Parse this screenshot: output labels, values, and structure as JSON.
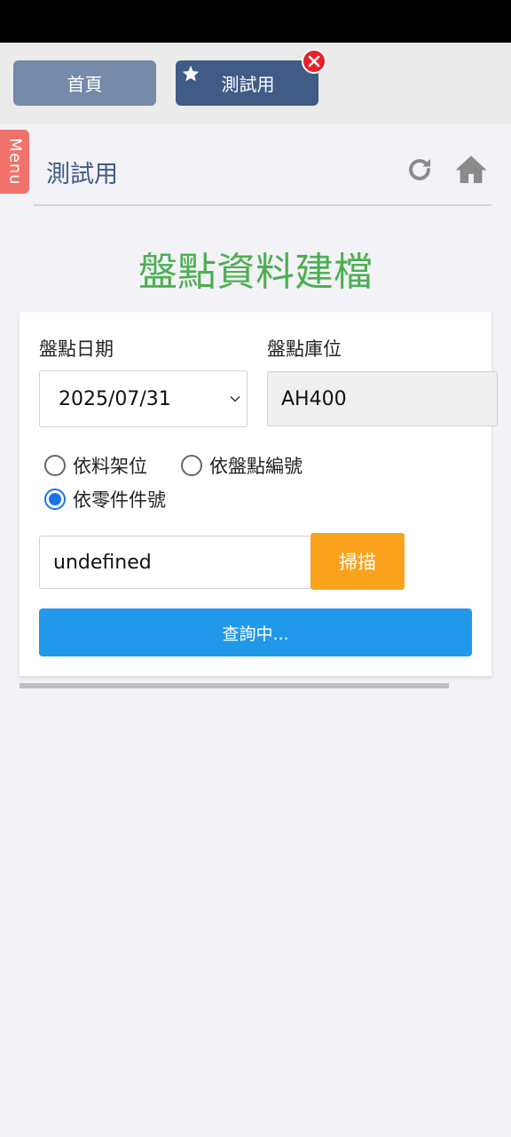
{
  "tabs": {
    "home_label": "首頁",
    "test_label": "測試用"
  },
  "side_menu": {
    "label": "Menu"
  },
  "header": {
    "title": "測試用"
  },
  "main": {
    "heading": "盤點資料建檔",
    "date_label": "盤點日期",
    "date_value": "2025/07/31",
    "location_label": "盤點庫位",
    "location_value": "AH400",
    "radio_options": [
      {
        "label": "依料架位",
        "checked": false
      },
      {
        "label": "依盤點編號",
        "checked": false
      },
      {
        "label": "依零件件號",
        "checked": true
      }
    ],
    "scan_value": "undefined",
    "scan_button": "掃描",
    "query_button": "查詢中..."
  },
  "colors": {
    "title_green": "#4caf50",
    "tab_active": "#3f5b86",
    "tab_inactive": "#7589a8",
    "menu_tab": "#f0726a",
    "scan_orange": "#fba21c",
    "query_blue": "#2298eb",
    "close_red": "#e8202a"
  },
  "icons": [
    "star-icon",
    "close-icon",
    "refresh-icon",
    "home-icon",
    "chevron-down-icon"
  ]
}
